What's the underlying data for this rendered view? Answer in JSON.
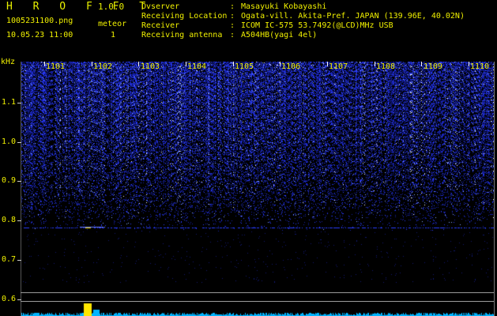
{
  "app": {
    "name": "H R O F F T",
    "version": "1.0.0"
  },
  "file": {
    "name": "1005231100.png",
    "datetime": "10.05.23 11:00"
  },
  "meteor": {
    "label": "meteor",
    "count": "1"
  },
  "info": [
    {
      "key": "Ovserver",
      "sep": ":",
      "value": "Masayuki Kobayashi"
    },
    {
      "key": "Receiving Location",
      "sep": ":",
      "value": "Ogata-vill. Akita-Pref. JAPAN (139.96E, 40.02N)"
    },
    {
      "key": "Receiver",
      "sep": ":",
      "value": "ICOM IC-575 53.7492(@LCD)MHz USB"
    },
    {
      "key": "Receiving antenna",
      "sep": ":",
      "value": "A504HB(yagi 4el)"
    }
  ],
  "y_axis": {
    "unit": "kHz",
    "labels": [
      "1.1",
      "1.0",
      "0.9",
      "0.8",
      "0.7",
      "0.6"
    ]
  },
  "x_axis": {
    "labels": [
      "1101",
      "1102",
      "1103",
      "1104",
      "1105",
      "1106",
      "1107",
      "1108",
      "1109",
      "1110"
    ]
  },
  "colors": {
    "text": "#f0f000",
    "noise": "#2233dd",
    "meteor": "#ffe600",
    "trace": "#00b4ff",
    "background": "#000000"
  }
}
